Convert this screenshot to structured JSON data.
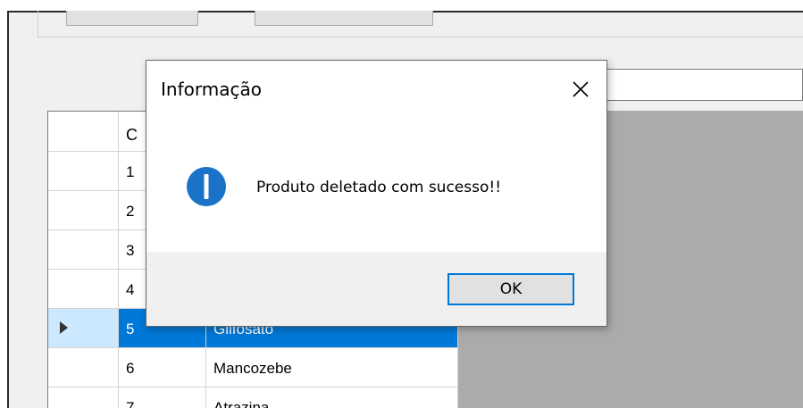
{
  "grid": {
    "header": {
      "id_col": "C",
      "name_col": ""
    },
    "rows": [
      {
        "id": "1",
        "name": "",
        "selected": false
      },
      {
        "id": "2",
        "name": "",
        "selected": false
      },
      {
        "id": "3",
        "name": "",
        "selected": false
      },
      {
        "id": "4",
        "name": "",
        "selected": false
      },
      {
        "id": "5",
        "name": "Glifosato",
        "selected": true
      },
      {
        "id": "6",
        "name": "Mancozebe",
        "selected": false
      },
      {
        "id": "7",
        "name": "Atrazina",
        "selected": false
      }
    ]
  },
  "dialog": {
    "title": "Informação",
    "message": "Produto deletado com sucesso!!",
    "ok_label": "OK",
    "icon": "info-icon",
    "close_icon": "close-icon"
  },
  "colors": {
    "selection": "#0078d7",
    "row_header_selected": "#cce8ff",
    "grid_background": "#ababab",
    "dialog_footer": "#f0f0f0"
  }
}
